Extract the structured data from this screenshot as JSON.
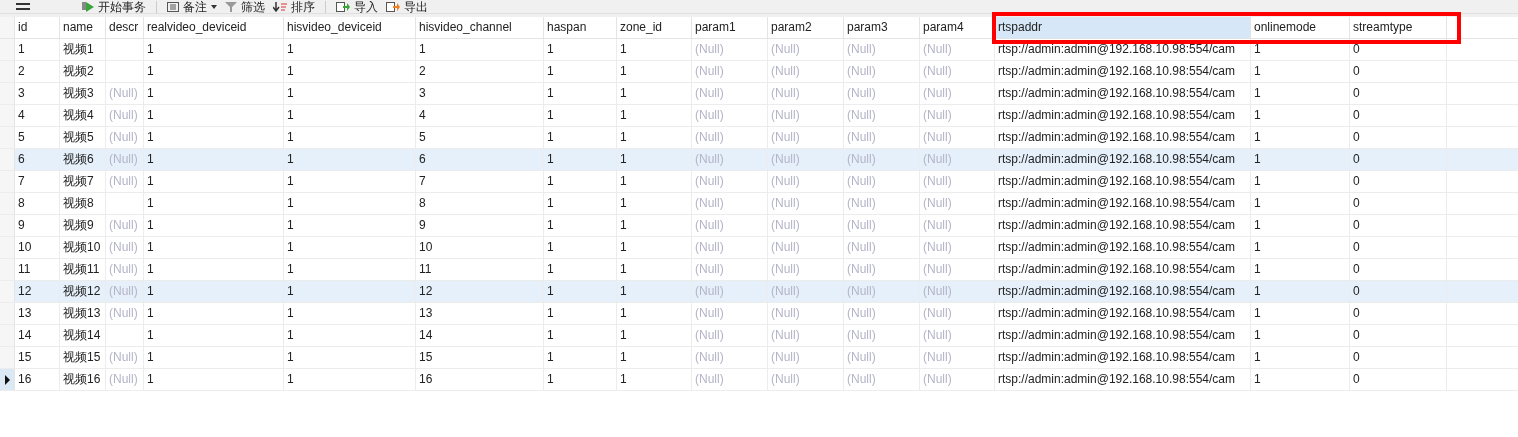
{
  "toolbar": [
    {
      "label": "开始事务"
    },
    {
      "label": "备注"
    },
    {
      "label": "筛选"
    },
    {
      "label": "排序"
    },
    {
      "label": "导入"
    },
    {
      "label": "导出"
    }
  ],
  "table": {
    "columns": [
      {
        "label": "id",
        "selected": false
      },
      {
        "label": "name",
        "selected": false
      },
      {
        "label": "descr",
        "selected": false
      },
      {
        "label": "realvideo_deviceid",
        "selected": false
      },
      {
        "label": "hisvideo_deviceid",
        "selected": false
      },
      {
        "label": "hisvideo_channel",
        "selected": false
      },
      {
        "label": "haspan",
        "selected": false
      },
      {
        "label": "zone_id",
        "selected": false
      },
      {
        "label": "param1",
        "selected": false
      },
      {
        "label": "param2",
        "selected": false
      },
      {
        "label": "param3",
        "selected": false
      },
      {
        "label": "param4",
        "selected": false
      },
      {
        "label": "rtspaddr",
        "selected": true
      },
      {
        "label": "onlinemode",
        "selected": false
      },
      {
        "label": "streamtype",
        "selected": false
      }
    ],
    "rows": [
      {
        "selected": false,
        "highlighted": false,
        "cells": [
          "1",
          "视频1",
          "",
          "1",
          "1",
          "1",
          "1",
          "1",
          "(Null)",
          "(Null)",
          "(Null)",
          "(Null)",
          "rtsp://admin:admin@192.168.10.98:554/cam",
          "1",
          "0"
        ]
      },
      {
        "selected": false,
        "highlighted": false,
        "cells": [
          "2",
          "视频2",
          "",
          "1",
          "1",
          "2",
          "1",
          "1",
          "(Null)",
          "(Null)",
          "(Null)",
          "(Null)",
          "rtsp://admin:admin@192.168.10.98:554/cam",
          "1",
          "0"
        ]
      },
      {
        "selected": false,
        "highlighted": false,
        "cells": [
          "3",
          "视频3",
          "(Null)",
          "1",
          "1",
          "3",
          "1",
          "1",
          "(Null)",
          "(Null)",
          "(Null)",
          "(Null)",
          "rtsp://admin:admin@192.168.10.98:554/cam",
          "1",
          "0"
        ]
      },
      {
        "selected": false,
        "highlighted": false,
        "cells": [
          "4",
          "视频4",
          "(Null)",
          "1",
          "1",
          "4",
          "1",
          "1",
          "(Null)",
          "(Null)",
          "(Null)",
          "(Null)",
          "rtsp://admin:admin@192.168.10.98:554/cam",
          "1",
          "0"
        ]
      },
      {
        "selected": false,
        "highlighted": false,
        "cells": [
          "5",
          "视频5",
          "(Null)",
          "1",
          "1",
          "5",
          "1",
          "1",
          "(Null)",
          "(Null)",
          "(Null)",
          "(Null)",
          "rtsp://admin:admin@192.168.10.98:554/cam",
          "1",
          "0"
        ]
      },
      {
        "selected": false,
        "highlighted": true,
        "cells": [
          "6",
          "视频6",
          "(Null)",
          "1",
          "1",
          "6",
          "1",
          "1",
          "(Null)",
          "(Null)",
          "(Null)",
          "(Null)",
          "rtsp://admin:admin@192.168.10.98:554/cam",
          "1",
          "0"
        ]
      },
      {
        "selected": false,
        "highlighted": false,
        "cells": [
          "7",
          "视频7",
          "(Null)",
          "1",
          "1",
          "7",
          "1",
          "1",
          "(Null)",
          "(Null)",
          "(Null)",
          "(Null)",
          "rtsp://admin:admin@192.168.10.98:554/cam",
          "1",
          "0"
        ]
      },
      {
        "selected": false,
        "highlighted": false,
        "cells": [
          "8",
          "视频8",
          "",
          "1",
          "1",
          "8",
          "1",
          "1",
          "(Null)",
          "(Null)",
          "(Null)",
          "(Null)",
          "rtsp://admin:admin@192.168.10.98:554/cam",
          "1",
          "0"
        ]
      },
      {
        "selected": false,
        "highlighted": false,
        "cells": [
          "9",
          "视频9",
          "(Null)",
          "1",
          "1",
          "9",
          "1",
          "1",
          "(Null)",
          "(Null)",
          "(Null)",
          "(Null)",
          "rtsp://admin:admin@192.168.10.98:554/cam",
          "1",
          "0"
        ]
      },
      {
        "selected": false,
        "highlighted": false,
        "cells": [
          "10",
          "视频10",
          "(Null)",
          "1",
          "1",
          "10",
          "1",
          "1",
          "(Null)",
          "(Null)",
          "(Null)",
          "(Null)",
          "rtsp://admin:admin@192.168.10.98:554/cam",
          "1",
          "0"
        ]
      },
      {
        "selected": false,
        "highlighted": false,
        "cells": [
          "11",
          "视频11",
          "(Null)",
          "1",
          "1",
          "11",
          "1",
          "1",
          "(Null)",
          "(Null)",
          "(Null)",
          "(Null)",
          "rtsp://admin:admin@192.168.10.98:554/cam",
          "1",
          "0"
        ]
      },
      {
        "selected": false,
        "highlighted": true,
        "cells": [
          "12",
          "视频12",
          "(Null)",
          "1",
          "1",
          "12",
          "1",
          "1",
          "(Null)",
          "(Null)",
          "(Null)",
          "(Null)",
          "rtsp://admin:admin@192.168.10.98:554/cam",
          "1",
          "0"
        ]
      },
      {
        "selected": false,
        "highlighted": false,
        "cells": [
          "13",
          "视频13",
          "(Null)",
          "1",
          "1",
          "13",
          "1",
          "1",
          "(Null)",
          "(Null)",
          "(Null)",
          "(Null)",
          "rtsp://admin:admin@192.168.10.98:554/cam",
          "1",
          "0"
        ]
      },
      {
        "selected": false,
        "highlighted": false,
        "cells": [
          "14",
          "视频14",
          "",
          "1",
          "1",
          "14",
          "1",
          "1",
          "(Null)",
          "(Null)",
          "(Null)",
          "(Null)",
          "rtsp://admin:admin@192.168.10.98:554/cam",
          "1",
          "0"
        ]
      },
      {
        "selected": false,
        "highlighted": false,
        "cells": [
          "15",
          "视频15",
          "(Null)",
          "1",
          "1",
          "15",
          "1",
          "1",
          "(Null)",
          "(Null)",
          "(Null)",
          "(Null)",
          "rtsp://admin:admin@192.168.10.98:554/cam",
          "1",
          "0"
        ]
      },
      {
        "selected": true,
        "highlighted": false,
        "cells": [
          "16",
          "视频16",
          "(Null)",
          "1",
          "1",
          "16",
          "1",
          "1",
          "(Null)",
          "(Null)",
          "(Null)",
          "(Null)",
          "rtsp://admin:admin@192.168.10.98:554/cam",
          "1",
          "0"
        ]
      }
    ]
  },
  "annotation": {
    "kind": "frame"
  }
}
